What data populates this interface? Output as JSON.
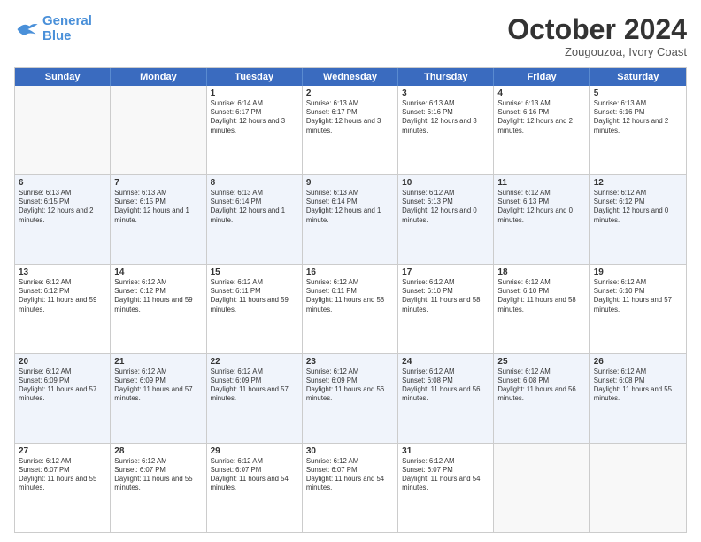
{
  "logo": {
    "line1": "General",
    "line2": "Blue"
  },
  "title": "October 2024",
  "subtitle": "Zougouzoa, Ivory Coast",
  "header_days": [
    "Sunday",
    "Monday",
    "Tuesday",
    "Wednesday",
    "Thursday",
    "Friday",
    "Saturday"
  ],
  "rows": [
    [
      {
        "day": "",
        "text": "",
        "empty": true
      },
      {
        "day": "",
        "text": "",
        "empty": true
      },
      {
        "day": "1",
        "text": "Sunrise: 6:14 AM\nSunset: 6:17 PM\nDaylight: 12 hours and 3 minutes.",
        "empty": false
      },
      {
        "day": "2",
        "text": "Sunrise: 6:13 AM\nSunset: 6:17 PM\nDaylight: 12 hours and 3 minutes.",
        "empty": false
      },
      {
        "day": "3",
        "text": "Sunrise: 6:13 AM\nSunset: 6:16 PM\nDaylight: 12 hours and 3 minutes.",
        "empty": false
      },
      {
        "day": "4",
        "text": "Sunrise: 6:13 AM\nSunset: 6:16 PM\nDaylight: 12 hours and 2 minutes.",
        "empty": false
      },
      {
        "day": "5",
        "text": "Sunrise: 6:13 AM\nSunset: 6:16 PM\nDaylight: 12 hours and 2 minutes.",
        "empty": false
      }
    ],
    [
      {
        "day": "6",
        "text": "Sunrise: 6:13 AM\nSunset: 6:15 PM\nDaylight: 12 hours and 2 minutes.",
        "empty": false
      },
      {
        "day": "7",
        "text": "Sunrise: 6:13 AM\nSunset: 6:15 PM\nDaylight: 12 hours and 1 minute.",
        "empty": false
      },
      {
        "day": "8",
        "text": "Sunrise: 6:13 AM\nSunset: 6:14 PM\nDaylight: 12 hours and 1 minute.",
        "empty": false
      },
      {
        "day": "9",
        "text": "Sunrise: 6:13 AM\nSunset: 6:14 PM\nDaylight: 12 hours and 1 minute.",
        "empty": false
      },
      {
        "day": "10",
        "text": "Sunrise: 6:12 AM\nSunset: 6:13 PM\nDaylight: 12 hours and 0 minutes.",
        "empty": false
      },
      {
        "day": "11",
        "text": "Sunrise: 6:12 AM\nSunset: 6:13 PM\nDaylight: 12 hours and 0 minutes.",
        "empty": false
      },
      {
        "day": "12",
        "text": "Sunrise: 6:12 AM\nSunset: 6:12 PM\nDaylight: 12 hours and 0 minutes.",
        "empty": false
      }
    ],
    [
      {
        "day": "13",
        "text": "Sunrise: 6:12 AM\nSunset: 6:12 PM\nDaylight: 11 hours and 59 minutes.",
        "empty": false
      },
      {
        "day": "14",
        "text": "Sunrise: 6:12 AM\nSunset: 6:12 PM\nDaylight: 11 hours and 59 minutes.",
        "empty": false
      },
      {
        "day": "15",
        "text": "Sunrise: 6:12 AM\nSunset: 6:11 PM\nDaylight: 11 hours and 59 minutes.",
        "empty": false
      },
      {
        "day": "16",
        "text": "Sunrise: 6:12 AM\nSunset: 6:11 PM\nDaylight: 11 hours and 58 minutes.",
        "empty": false
      },
      {
        "day": "17",
        "text": "Sunrise: 6:12 AM\nSunset: 6:10 PM\nDaylight: 11 hours and 58 minutes.",
        "empty": false
      },
      {
        "day": "18",
        "text": "Sunrise: 6:12 AM\nSunset: 6:10 PM\nDaylight: 11 hours and 58 minutes.",
        "empty": false
      },
      {
        "day": "19",
        "text": "Sunrise: 6:12 AM\nSunset: 6:10 PM\nDaylight: 11 hours and 57 minutes.",
        "empty": false
      }
    ],
    [
      {
        "day": "20",
        "text": "Sunrise: 6:12 AM\nSunset: 6:09 PM\nDaylight: 11 hours and 57 minutes.",
        "empty": false
      },
      {
        "day": "21",
        "text": "Sunrise: 6:12 AM\nSunset: 6:09 PM\nDaylight: 11 hours and 57 minutes.",
        "empty": false
      },
      {
        "day": "22",
        "text": "Sunrise: 6:12 AM\nSunset: 6:09 PM\nDaylight: 11 hours and 57 minutes.",
        "empty": false
      },
      {
        "day": "23",
        "text": "Sunrise: 6:12 AM\nSunset: 6:09 PM\nDaylight: 11 hours and 56 minutes.",
        "empty": false
      },
      {
        "day": "24",
        "text": "Sunrise: 6:12 AM\nSunset: 6:08 PM\nDaylight: 11 hours and 56 minutes.",
        "empty": false
      },
      {
        "day": "25",
        "text": "Sunrise: 6:12 AM\nSunset: 6:08 PM\nDaylight: 11 hours and 56 minutes.",
        "empty": false
      },
      {
        "day": "26",
        "text": "Sunrise: 6:12 AM\nSunset: 6:08 PM\nDaylight: 11 hours and 55 minutes.",
        "empty": false
      }
    ],
    [
      {
        "day": "27",
        "text": "Sunrise: 6:12 AM\nSunset: 6:07 PM\nDaylight: 11 hours and 55 minutes.",
        "empty": false
      },
      {
        "day": "28",
        "text": "Sunrise: 6:12 AM\nSunset: 6:07 PM\nDaylight: 11 hours and 55 minutes.",
        "empty": false
      },
      {
        "day": "29",
        "text": "Sunrise: 6:12 AM\nSunset: 6:07 PM\nDaylight: 11 hours and 54 minutes.",
        "empty": false
      },
      {
        "day": "30",
        "text": "Sunrise: 6:12 AM\nSunset: 6:07 PM\nDaylight: 11 hours and 54 minutes.",
        "empty": false
      },
      {
        "day": "31",
        "text": "Sunrise: 6:12 AM\nSunset: 6:07 PM\nDaylight: 11 hours and 54 minutes.",
        "empty": false
      },
      {
        "day": "",
        "text": "",
        "empty": true
      },
      {
        "day": "",
        "text": "",
        "empty": true
      }
    ]
  ],
  "alt_rows": [
    1,
    3
  ]
}
